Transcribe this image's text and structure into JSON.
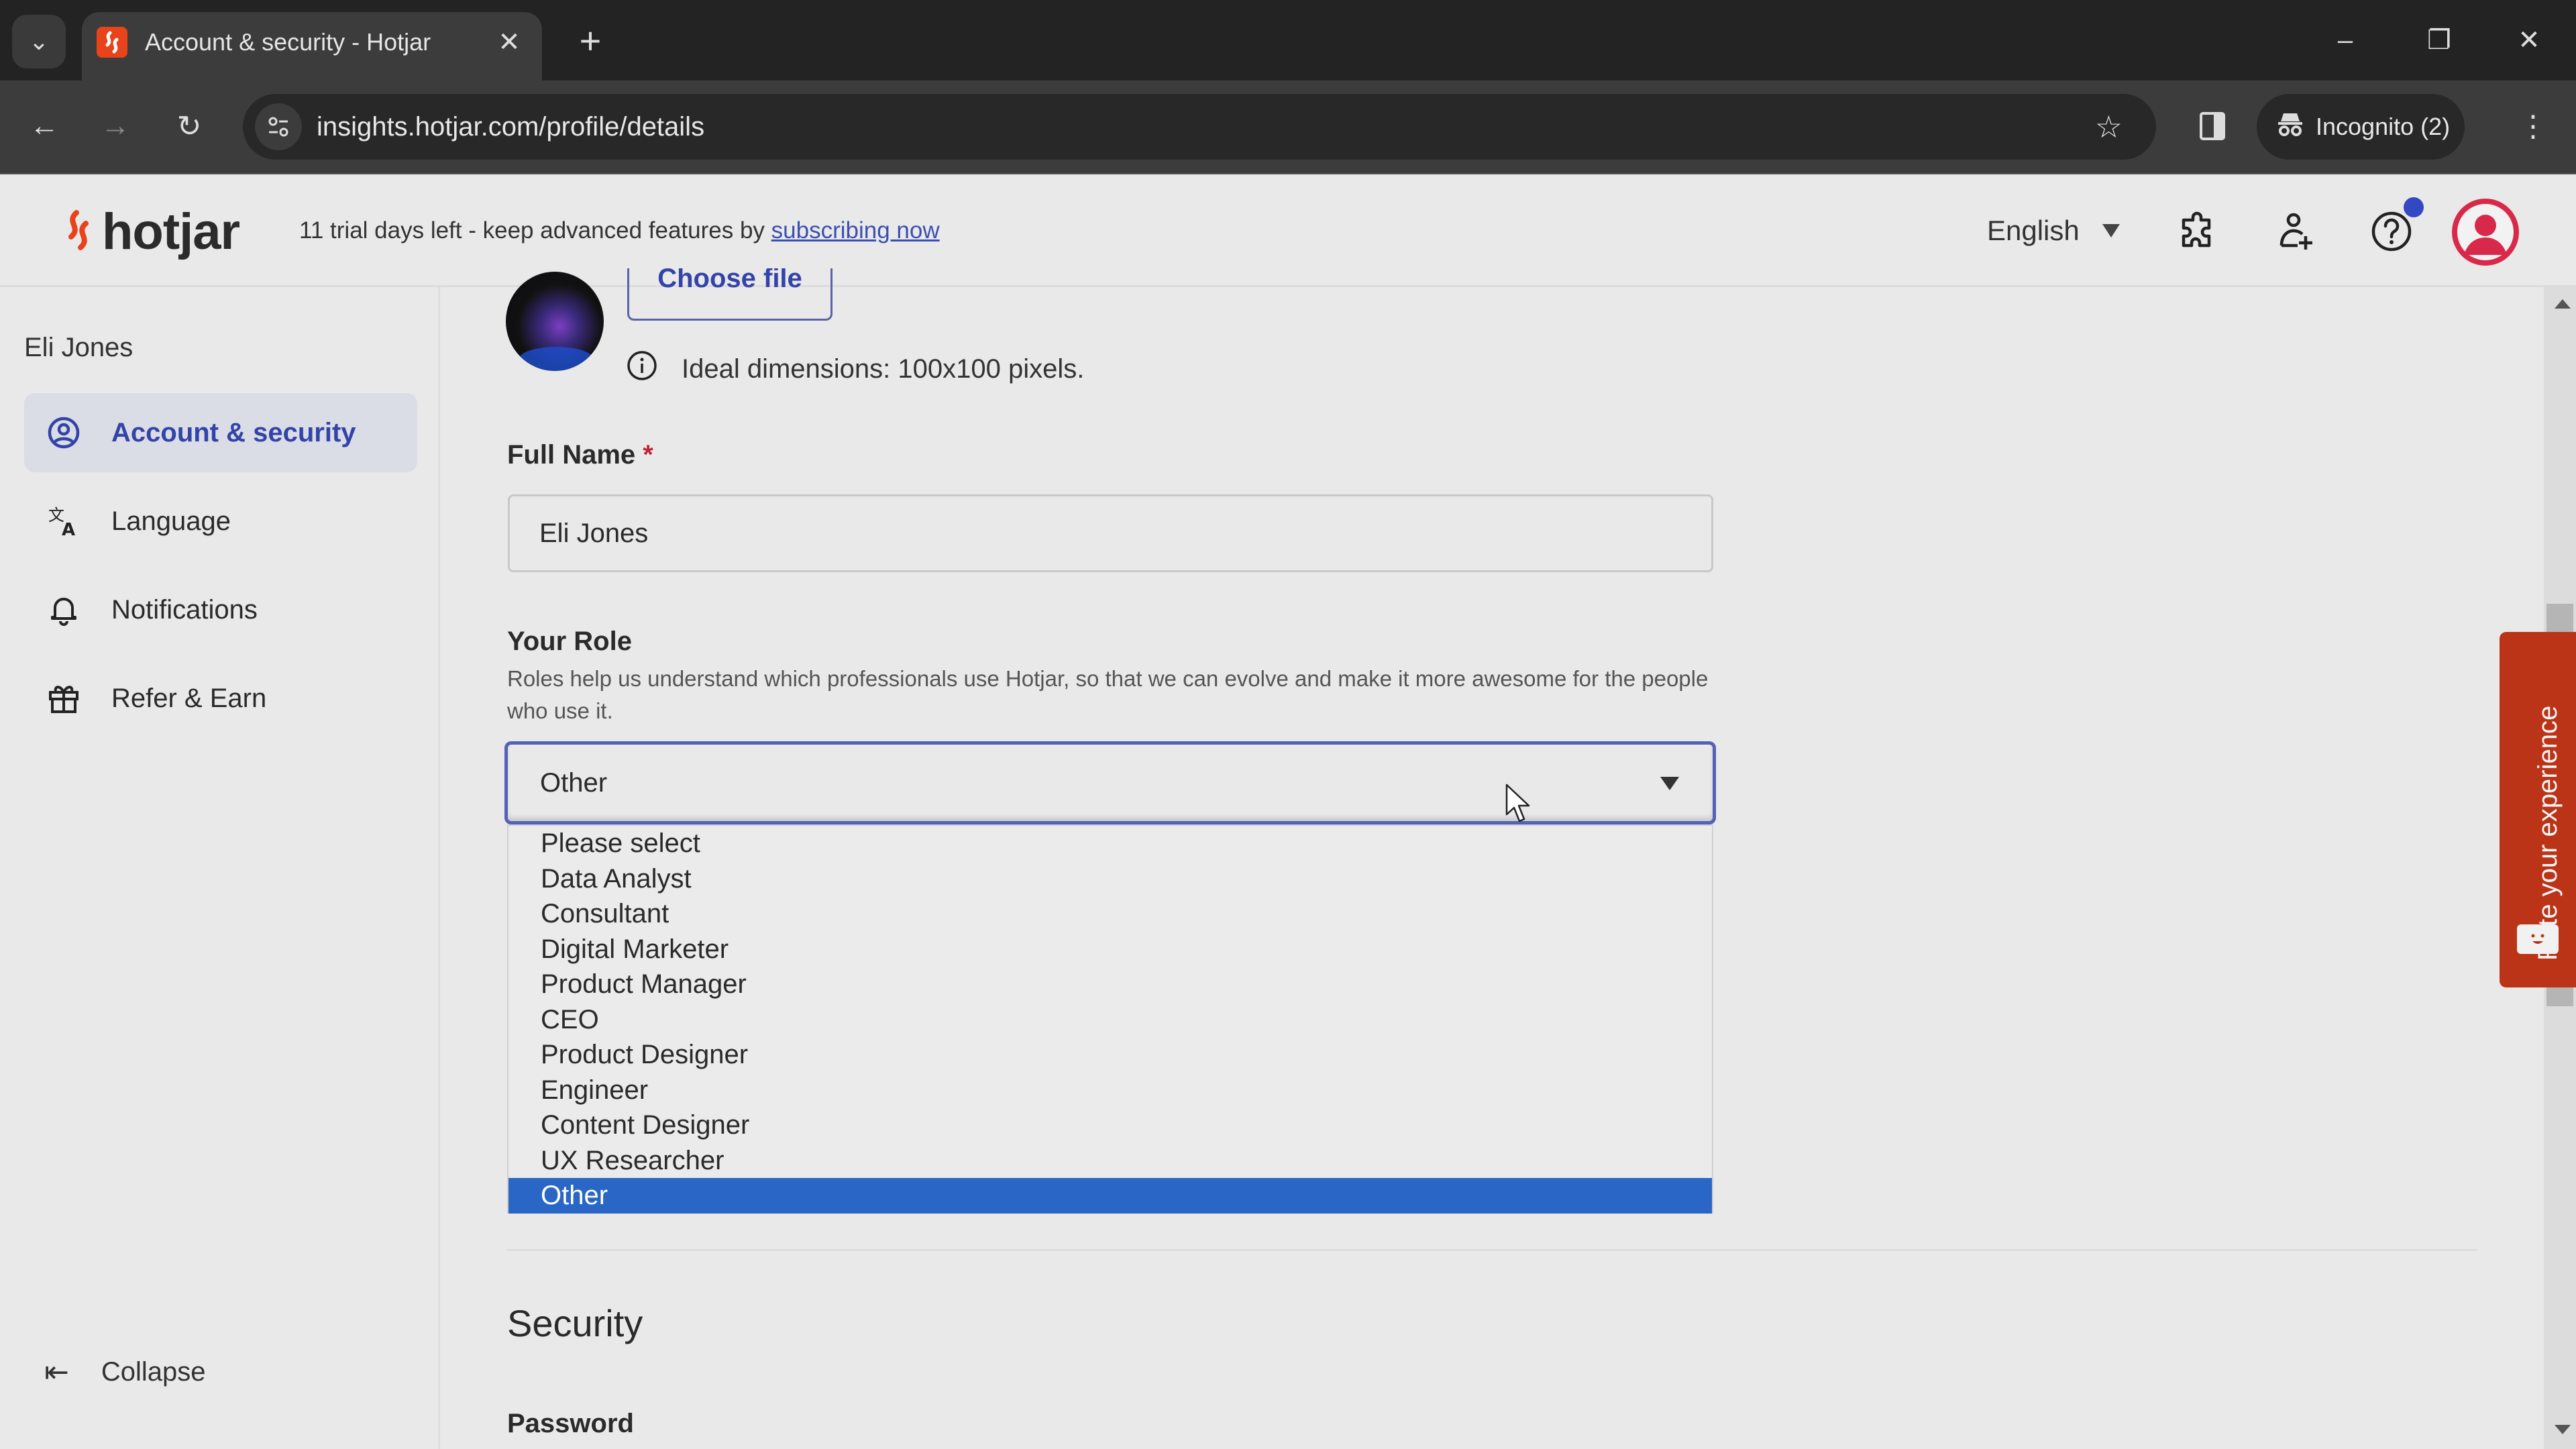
{
  "browser": {
    "tab_title": "Account & security - Hotjar",
    "url": "insights.hotjar.com/profile/details",
    "incognito_label": "Incognito (2)"
  },
  "header": {
    "logo_text": "hotjar",
    "trial_text": "11 trial days left - keep advanced features by ",
    "trial_link": "subscribing now",
    "language": "English"
  },
  "sidebar": {
    "user_name": "Eli Jones",
    "items": [
      {
        "label": "Account & security",
        "icon": "user-circle-icon",
        "active": true
      },
      {
        "label": "Language",
        "icon": "translate-icon",
        "active": false
      },
      {
        "label": "Notifications",
        "icon": "bell-icon",
        "active": false
      },
      {
        "label": "Refer & Earn",
        "icon": "gift-icon",
        "active": false
      }
    ],
    "collapse_label": "Collapse"
  },
  "profile": {
    "choose_file_label": "Choose file",
    "dimensions_hint": "Ideal dimensions: 100x100 pixels.",
    "full_name_label": "Full Name",
    "required_mark": "*",
    "full_name_value": "Eli Jones",
    "role_label": "Your Role",
    "role_help": "Roles help us understand which professionals use Hotjar, so that we can evolve and make it more awesome for the people who use it.",
    "role_value": "Other",
    "role_options": [
      "Please select",
      "Data Analyst",
      "Consultant",
      "Digital Marketer",
      "Product Manager",
      "CEO",
      "Product Designer",
      "Engineer",
      "Content Designer",
      "UX Researcher",
      "Other"
    ],
    "role_selected_index": 10
  },
  "security": {
    "title": "Security",
    "password_label": "Password"
  },
  "feedback": {
    "label": "Rate your experience"
  },
  "colors": {
    "brand": "#e8431a",
    "accent": "#3443a8",
    "selected_option": "#2a66c5",
    "feedback_tab": "#bc3418",
    "avatar": "#d8294a",
    "notification_dot": "#3349c4"
  }
}
